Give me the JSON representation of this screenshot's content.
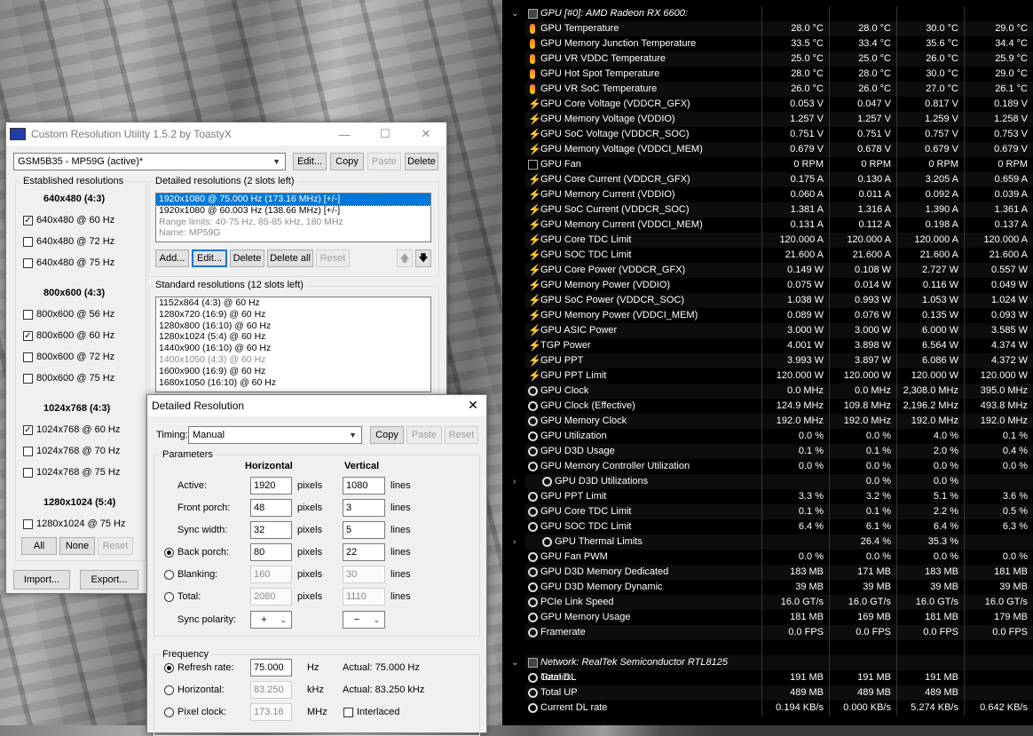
{
  "cru": {
    "title": "Custom Resolution Utility 1.5.2 by ToastyX",
    "monitor": "GSM5B35 - MP59G (active)*",
    "top_buttons": [
      "Edit...",
      "Copy",
      "Paste",
      "Delete"
    ],
    "established_label": "Established resolutions",
    "established_groups": [
      {
        "title": "640x480 (4:3)",
        "items": [
          {
            "label": "640x480 @ 60 Hz",
            "checked": true
          },
          {
            "label": "640x480 @ 72 Hz",
            "checked": false
          },
          {
            "label": "640x480 @ 75 Hz",
            "checked": false
          }
        ]
      },
      {
        "title": "800x600 (4:3)",
        "items": [
          {
            "label": "800x600 @ 56 Hz",
            "checked": false
          },
          {
            "label": "800x600 @ 60 Hz",
            "checked": true
          },
          {
            "label": "800x600 @ 72 Hz",
            "checked": false
          },
          {
            "label": "800x600 @ 75 Hz",
            "checked": false
          }
        ]
      },
      {
        "title": "1024x768 (4:3)",
        "items": [
          {
            "label": "1024x768 @ 60 Hz",
            "checked": true
          },
          {
            "label": "1024x768 @ 70 Hz",
            "checked": false
          },
          {
            "label": "1024x768 @ 75 Hz",
            "checked": false
          }
        ]
      },
      {
        "title": "1280x1024 (5:4)",
        "items": [
          {
            "label": "1280x1024 @ 75 Hz",
            "checked": false
          }
        ]
      }
    ],
    "est_buttons": [
      "All",
      "None",
      "Reset"
    ],
    "detailed_label": "Detailed resolutions (2 slots left)",
    "detailed_items": [
      "1920x1080 @ 75.000 Hz (173.16 MHz) [+/-]",
      "1920x1080 @ 60.003 Hz (138.66 MHz) [+/-]",
      "Range limits: 40-75 Hz, 85-85 kHz, 180 MHz",
      "Name: MP59G"
    ],
    "detailed_buttons": [
      "Add...",
      "Edit...",
      "Delete",
      "Delete all",
      "Reset"
    ],
    "up_arrow": "🡅",
    "down_arrow": "🡇",
    "standard_label": "Standard resolutions (12 slots left)",
    "standard_items": [
      "1152x864 (4:3) @ 60 Hz",
      "1280x720 (16:9) @ 60 Hz",
      "1280x800 (16:10) @ 60 Hz",
      "1280x1024 (5:4) @ 60 Hz",
      "1440x900 (16:10) @ 60 Hz",
      "1400x1050 (4:3) @ 60 Hz",
      "1600x900 (16:9) @ 60 Hz",
      "1680x1050 (16:10) @ 60 Hz"
    ],
    "bottom_buttons": [
      "Import...",
      "Export..."
    ]
  },
  "dr": {
    "title": "Detailed Resolution",
    "timing_label": "Timing:",
    "timing_value": "Manual",
    "buttons": [
      "Copy",
      "Paste",
      "Reset"
    ],
    "params_label": "Parameters",
    "h_header": "Horizontal",
    "v_header": "Vertical",
    "rows": [
      {
        "label": "Active:",
        "h": "1920",
        "hu": "pixels",
        "v": "1080",
        "vu": "lines",
        "radio": false
      },
      {
        "label": "Front porch:",
        "h": "48",
        "hu": "pixels",
        "v": "3",
        "vu": "lines",
        "radio": false
      },
      {
        "label": "Sync width:",
        "h": "32",
        "hu": "pixels",
        "v": "5",
        "vu": "lines",
        "radio": false
      },
      {
        "label": "Back porch:",
        "h": "80",
        "hu": "pixels",
        "v": "22",
        "vu": "lines",
        "radio": true,
        "on": true
      },
      {
        "label": "Blanking:",
        "h": "160",
        "hu": "pixels",
        "v": "30",
        "vu": "lines",
        "radio": true,
        "on": false,
        "dis": true
      },
      {
        "label": "Total:",
        "h": "2080",
        "hu": "pixels",
        "v": "1110",
        "vu": "lines",
        "radio": true,
        "on": false,
        "dis": true
      }
    ],
    "sync_label": "Sync polarity:",
    "sync_h": "+",
    "sync_v": "−",
    "freq_label": "Frequency",
    "freq_rows": [
      {
        "label": "Refresh rate:",
        "value": "75.000",
        "unit": "Hz",
        "actual": "Actual: 75.000 Hz",
        "on": true
      },
      {
        "label": "Horizontal:",
        "value": "83.250",
        "unit": "kHz",
        "actual": "Actual: 83.250 kHz",
        "on": false
      },
      {
        "label": "Pixel clock:",
        "value": "173.16",
        "unit": "MHz",
        "actual": "Interlaced",
        "on": false
      }
    ]
  },
  "hw": {
    "gpu_header": "GPU [#0]: AMD Radeon RX 6600:",
    "net_header": "Network: RealTek Semiconductor RTL8125 Gamin...",
    "rows": [
      {
        "icon": "temp",
        "name": "GPU Temperature",
        "v": [
          "28.0 °C",
          "28.0 °C",
          "30.0 °C",
          "29.0 °C"
        ]
      },
      {
        "icon": "temp",
        "name": "GPU Memory Junction Temperature",
        "v": [
          "33.5 °C",
          "33.4 °C",
          "35.6 °C",
          "34.4 °C"
        ]
      },
      {
        "icon": "temp",
        "name": "GPU VR VDDC Temperature",
        "v": [
          "25.0 °C",
          "25.0 °C",
          "26.0 °C",
          "25.9 °C"
        ]
      },
      {
        "icon": "temp",
        "name": "GPU Hot Spot Temperature",
        "v": [
          "28.0 °C",
          "28.0 °C",
          "30.0 °C",
          "29.0 °C"
        ]
      },
      {
        "icon": "temp",
        "name": "GPU VR SoC Temperature",
        "v": [
          "26.0 °C",
          "26.0 °C",
          "27.0 °C",
          "26.1 °C"
        ]
      },
      {
        "icon": "volt",
        "name": "GPU Core Voltage (VDDCR_GFX)",
        "v": [
          "0.053 V",
          "0.047 V",
          "0.817 V",
          "0.189 V"
        ]
      },
      {
        "icon": "volt",
        "name": "GPU Memory Voltage (VDDIO)",
        "v": [
          "1.257 V",
          "1.257 V",
          "1.259 V",
          "1.258 V"
        ]
      },
      {
        "icon": "volt",
        "name": "GPU SoC Voltage (VDDCR_SOC)",
        "v": [
          "0.751 V",
          "0.751 V",
          "0.757 V",
          "0.753 V"
        ]
      },
      {
        "icon": "volt",
        "name": "GPU Memory Voltage (VDDCI_MEM)",
        "v": [
          "0.679 V",
          "0.678 V",
          "0.679 V",
          "0.679 V"
        ]
      },
      {
        "icon": "fan",
        "name": "GPU Fan",
        "v": [
          "0 RPM",
          "0 RPM",
          "0 RPM",
          "0 RPM"
        ]
      },
      {
        "icon": "volt",
        "name": "GPU Core Current (VDDCR_GFX)",
        "v": [
          "0.175 A",
          "0.130 A",
          "3.205 A",
          "0.659 A"
        ]
      },
      {
        "icon": "volt",
        "name": "GPU Memory Current (VDDIO)",
        "v": [
          "0.060 A",
          "0.011 A",
          "0.092 A",
          "0.039 A"
        ]
      },
      {
        "icon": "volt",
        "name": "GPU SoC Current (VDDCR_SOC)",
        "v": [
          "1.381 A",
          "1.316 A",
          "1.390 A",
          "1.361 A"
        ]
      },
      {
        "icon": "volt",
        "name": "GPU Memory Current (VDDCI_MEM)",
        "v": [
          "0.131 A",
          "0.112 A",
          "0.198 A",
          "0.137 A"
        ]
      },
      {
        "icon": "volt",
        "name": "GPU Core TDC Limit",
        "v": [
          "120.000 A",
          "120.000 A",
          "120.000 A",
          "120.000 A"
        ]
      },
      {
        "icon": "volt",
        "name": "GPU SOC TDC Limit",
        "v": [
          "21.600 A",
          "21.600 A",
          "21.600 A",
          "21.600 A"
        ]
      },
      {
        "icon": "volt",
        "name": "GPU Core Power (VDDCR_GFX)",
        "v": [
          "0.149 W",
          "0.108 W",
          "2.727 W",
          "0.557 W"
        ]
      },
      {
        "icon": "volt",
        "name": "GPU Memory Power (VDDIO)",
        "v": [
          "0.075 W",
          "0.014 W",
          "0.116 W",
          "0.049 W"
        ]
      },
      {
        "icon": "volt",
        "name": "GPU SoC Power (VDDCR_SOC)",
        "v": [
          "1.038 W",
          "0.993 W",
          "1.053 W",
          "1.024 W"
        ]
      },
      {
        "icon": "volt",
        "name": "GPU Memory Power (VDDCI_MEM)",
        "v": [
          "0.089 W",
          "0.076 W",
          "0.135 W",
          "0.093 W"
        ]
      },
      {
        "icon": "volt",
        "name": "GPU ASIC Power",
        "v": [
          "3.000 W",
          "3.000 W",
          "6.000 W",
          "3.585 W"
        ]
      },
      {
        "icon": "volt",
        "name": "TGP Power",
        "v": [
          "4.001 W",
          "3.898 W",
          "6.564 W",
          "4.374 W"
        ]
      },
      {
        "icon": "volt",
        "name": "GPU PPT",
        "v": [
          "3.993 W",
          "3.897 W",
          "6.086 W",
          "4.372 W"
        ]
      },
      {
        "icon": "volt",
        "name": "GPU PPT Limit",
        "v": [
          "120.000 W",
          "120.000 W",
          "120.000 W",
          "120.000 W"
        ]
      },
      {
        "icon": "clock",
        "name": "GPU Clock",
        "v": [
          "0.0 MHz",
          "0.0 MHz",
          "2,308.0 MHz",
          "395.0 MHz"
        ]
      },
      {
        "icon": "clock",
        "name": "GPU Clock (Effective)",
        "v": [
          "124.9 MHz",
          "109.8 MHz",
          "2,196.2 MHz",
          "493.8 MHz"
        ]
      },
      {
        "icon": "clock",
        "name": "GPU Memory Clock",
        "v": [
          "192.0 MHz",
          "192.0 MHz",
          "192.0 MHz",
          "192.0 MHz"
        ]
      },
      {
        "icon": "clock",
        "name": "GPU Utilization",
        "v": [
          "0.0 %",
          "0.0 %",
          "4.0 %",
          "0.1 %"
        ]
      },
      {
        "icon": "clock",
        "name": "GPU D3D Usage",
        "v": [
          "0.1 %",
          "0.1 %",
          "2.0 %",
          "0.4 %"
        ]
      },
      {
        "icon": "clock",
        "name": "GPU Memory Controller Utilization",
        "v": [
          "0.0 %",
          "0.0 %",
          "0.0 %",
          "0.0 %"
        ]
      },
      {
        "icon": "clock",
        "name": "GPU D3D Utilizations",
        "v": [
          "",
          "0.0 %",
          "0.0 %",
          ""
        ],
        "expander": true
      },
      {
        "icon": "clock",
        "name": "GPU PPT Limit",
        "v": [
          "3.3 %",
          "3.2 %",
          "5.1 %",
          "3.6 %"
        ]
      },
      {
        "icon": "clock",
        "name": "GPU Core TDC Limit",
        "v": [
          "0.1 %",
          "0.1 %",
          "2.2 %",
          "0.5 %"
        ]
      },
      {
        "icon": "clock",
        "name": "GPU SOC TDC Limit",
        "v": [
          "6.4 %",
          "6.1 %",
          "6.4 %",
          "6.3 %"
        ]
      },
      {
        "icon": "clock",
        "name": "GPU Thermal Limits",
        "v": [
          "",
          "26.4 %",
          "35.3 %",
          ""
        ],
        "expander": true
      },
      {
        "icon": "clock",
        "name": "GPU Fan PWM",
        "v": [
          "0.0 %",
          "0.0 %",
          "0.0 %",
          "0.0 %"
        ]
      },
      {
        "icon": "clock",
        "name": "GPU D3D Memory Dedicated",
        "v": [
          "183 MB",
          "171 MB",
          "183 MB",
          "181 MB"
        ]
      },
      {
        "icon": "clock",
        "name": "GPU D3D Memory Dynamic",
        "v": [
          "39 MB",
          "39 MB",
          "39 MB",
          "39 MB"
        ]
      },
      {
        "icon": "clock",
        "name": "PCIe Link Speed",
        "v": [
          "16.0 GT/s",
          "16.0 GT/s",
          "16.0 GT/s",
          "16.0 GT/s"
        ]
      },
      {
        "icon": "clock",
        "name": "GPU Memory Usage",
        "v": [
          "181 MB",
          "169 MB",
          "181 MB",
          "179 MB"
        ]
      },
      {
        "icon": "clock",
        "name": "Framerate",
        "v": [
          "0.0 FPS",
          "0.0 FPS",
          "0.0 FPS",
          "0.0 FPS"
        ]
      }
    ],
    "net_rows": [
      {
        "icon": "clock",
        "name": "Total DL",
        "v": [
          "191 MB",
          "191 MB",
          "191 MB",
          ""
        ]
      },
      {
        "icon": "clock",
        "name": "Total UP",
        "v": [
          "489 MB",
          "489 MB",
          "489 MB",
          ""
        ]
      },
      {
        "icon": "clock",
        "name": "Current DL rate",
        "v": [
          "0.194 KB/s",
          "0.000 KB/s",
          "5.274 KB/s",
          "0.642 KB/s"
        ]
      }
    ]
  }
}
